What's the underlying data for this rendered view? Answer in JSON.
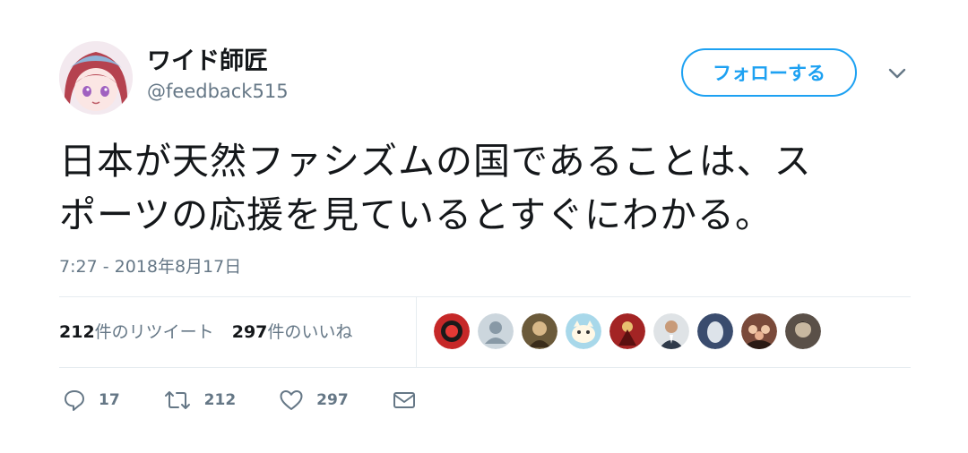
{
  "user": {
    "display_name": "ワイド師匠",
    "handle": "@feedback515",
    "avatar_icon": "user-avatar-anime-girl"
  },
  "follow_button": {
    "label": "フォローする",
    "color": "#1da1f2"
  },
  "tweet": {
    "lines": [
      "日本が天然ファシズムの国であることは、ス",
      "ポーツの応援を見ているとすぐにわかる。"
    ],
    "timestamp": "7:27 - 2018年8月17日"
  },
  "stats": {
    "retweets": {
      "count": "212",
      "label": "件のリツイート"
    },
    "likes": {
      "count": "297",
      "label": "件のいいね"
    }
  },
  "likers": [
    {
      "icon": "liker-avatar-red-logo",
      "color": "#c62828"
    },
    {
      "icon": "liker-avatar-default",
      "color": "#ccd6dd"
    },
    {
      "icon": "liker-avatar-character",
      "color": "#6b5a3a"
    },
    {
      "icon": "liker-avatar-cat-mascot",
      "color": "#a8d8ea"
    },
    {
      "icon": "liker-avatar-red-figure",
      "color": "#a32424"
    },
    {
      "icon": "liker-avatar-person-suit",
      "color": "#2f3a4a"
    },
    {
      "icon": "liker-avatar-egg",
      "color": "#3a4c6e"
    },
    {
      "icon": "liker-avatar-group",
      "color": "#7a4a3a"
    },
    {
      "icon": "liker-avatar-dark-character",
      "color": "#5a5048"
    }
  ],
  "actions": {
    "reply": {
      "icon": "reply-icon",
      "count": "17"
    },
    "retweet": {
      "icon": "retweet-icon",
      "count": "212"
    },
    "like": {
      "icon": "heart-icon",
      "count": "297"
    },
    "dm": {
      "icon": "envelope-icon"
    }
  },
  "colors": {
    "accent": "#1da1f2",
    "text": "#14171a",
    "secondary": "#657786",
    "divider": "#e6ecf0"
  }
}
